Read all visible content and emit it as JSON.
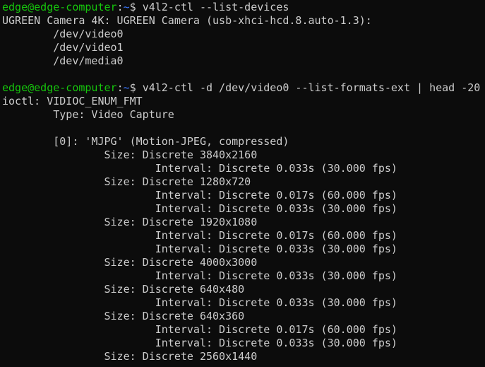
{
  "terminal": {
    "colors": {
      "background": "#0c0c0c",
      "foreground": "#cccccc",
      "prompt_user": "#16c60c",
      "prompt_path": "#3b78ff"
    },
    "prompt": {
      "user_host": "edge@edge-computer",
      "separator": ":",
      "path": "~",
      "symbol": "$ "
    },
    "commands": [
      "v4l2-ctl --list-devices",
      "v4l2-ctl -d /dev/video0 --list-formats-ext | head -20"
    ],
    "output_1": [
      "UGREEN Camera 4K: UGREEN Camera (usb-xhci-hcd.8.auto-1.3):",
      "        /dev/video0",
      "        /dev/video1",
      "        /dev/media0",
      ""
    ],
    "output_2": [
      "ioctl: VIDIOC_ENUM_FMT",
      "        Type: Video Capture",
      "",
      "        [0]: 'MJPG' (Motion-JPEG, compressed)",
      "                Size: Discrete 3840x2160",
      "                        Interval: Discrete 0.033s (30.000 fps)",
      "                Size: Discrete 1280x720",
      "                        Interval: Discrete 0.017s (60.000 fps)",
      "                        Interval: Discrete 0.033s (30.000 fps)",
      "                Size: Discrete 1920x1080",
      "                        Interval: Discrete 0.017s (60.000 fps)",
      "                        Interval: Discrete 0.033s (30.000 fps)",
      "                Size: Discrete 4000x3000",
      "                        Interval: Discrete 0.033s (30.000 fps)",
      "                Size: Discrete 640x480",
      "                        Interval: Discrete 0.033s (30.000 fps)",
      "                Size: Discrete 640x360",
      "                        Interval: Discrete 0.017s (60.000 fps)",
      "                        Interval: Discrete 0.033s (30.000 fps)",
      "                Size: Discrete 2560x1440"
    ]
  }
}
